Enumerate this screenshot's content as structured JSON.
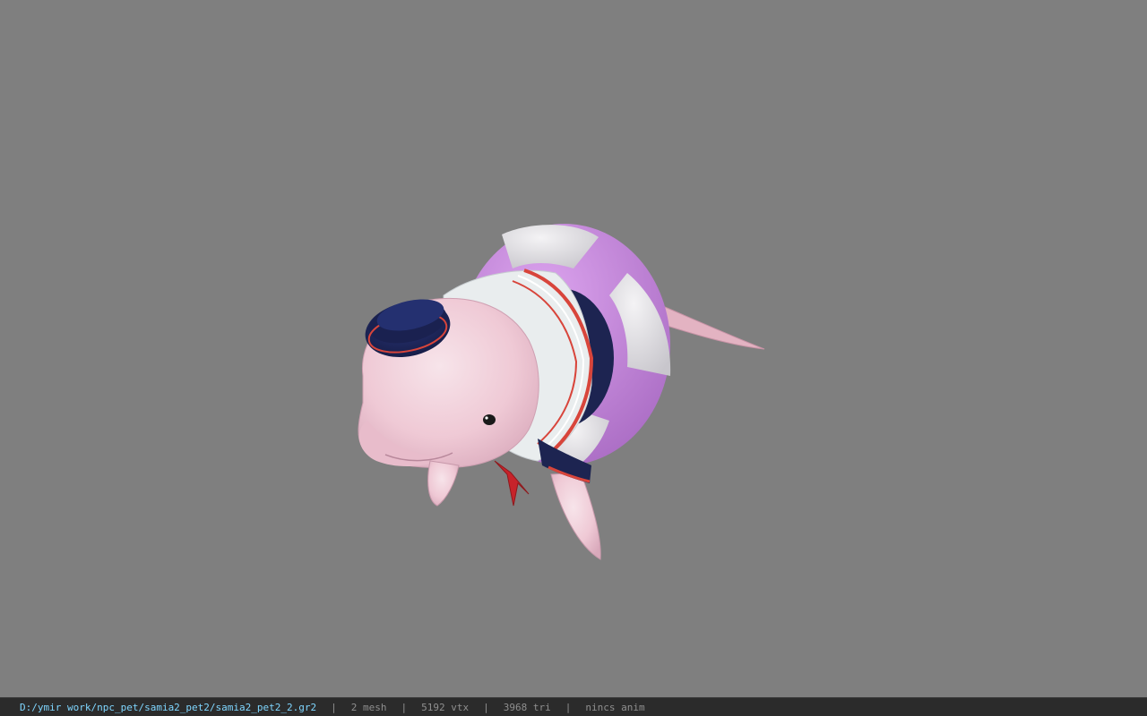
{
  "viewport": {
    "background_color": "#7f7f7f",
    "model": {
      "subject": "beluga-pet-model",
      "colors": {
        "skin": "#f0cdd8",
        "ring_light": "#e8e6ea",
        "ring_purple": "#c57fdc",
        "collar": "#eaeeef",
        "navy": "#1d2451",
        "red_trim": "#d8453b"
      }
    }
  },
  "statusbar": {
    "file_path": "D:/ymir work/npc_pet/samia2_pet2/samia2_pet2_2.gr2",
    "separator": "|",
    "mesh_count": "2 mesh",
    "vertex_count": "5192 vtx",
    "triangle_count": "3968 tri",
    "animation": "nincs anim"
  }
}
